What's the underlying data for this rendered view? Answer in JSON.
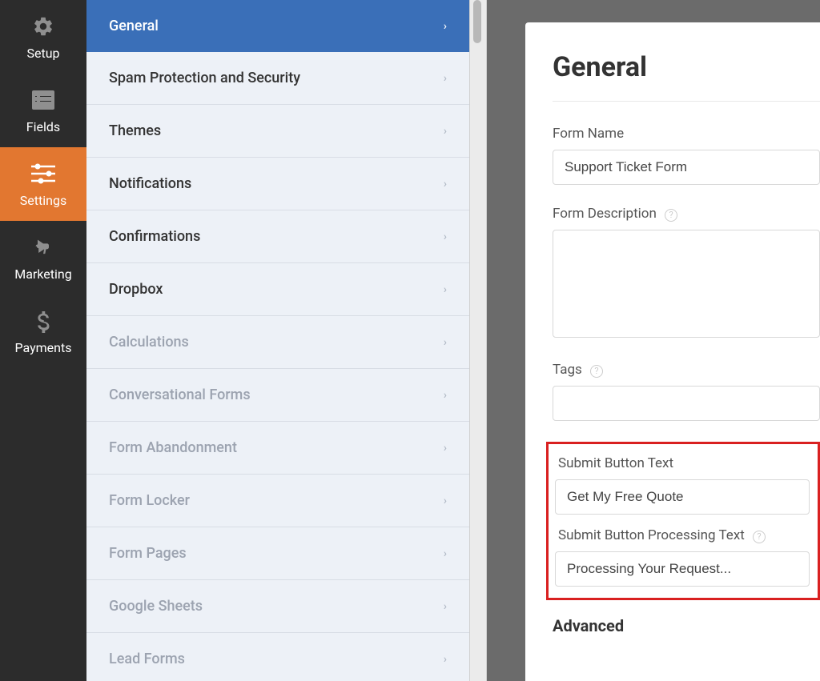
{
  "sidebar": {
    "items": [
      {
        "label": "Setup",
        "icon": "gear"
      },
      {
        "label": "Fields",
        "icon": "list"
      },
      {
        "label": "Settings",
        "icon": "sliders"
      },
      {
        "label": "Marketing",
        "icon": "bullhorn"
      },
      {
        "label": "Payments",
        "icon": "dollar"
      }
    ]
  },
  "settings_panel": {
    "items": [
      {
        "label": "General",
        "selected": true
      },
      {
        "label": "Spam Protection and Security"
      },
      {
        "label": "Themes"
      },
      {
        "label": "Notifications"
      },
      {
        "label": "Confirmations"
      },
      {
        "label": "Dropbox"
      },
      {
        "label": "Calculations",
        "disabled": true
      },
      {
        "label": "Conversational Forms",
        "disabled": true
      },
      {
        "label": "Form Abandonment",
        "disabled": true
      },
      {
        "label": "Form Locker",
        "disabled": true
      },
      {
        "label": "Form Pages",
        "disabled": true
      },
      {
        "label": "Google Sheets",
        "disabled": true
      },
      {
        "label": "Lead Forms",
        "disabled": true
      }
    ]
  },
  "content": {
    "title": "General",
    "fields": {
      "form_name_label": "Form Name",
      "form_name_value": "Support Ticket Form",
      "form_description_label": "Form Description",
      "form_description_value": "",
      "tags_label": "Tags",
      "tags_value": "",
      "submit_button_text_label": "Submit Button Text",
      "submit_button_text_value": "Get My Free Quote",
      "submit_button_processing_label": "Submit Button Processing Text",
      "submit_button_processing_value": "Processing Your Request...",
      "advanced_heading": "Advanced"
    }
  }
}
